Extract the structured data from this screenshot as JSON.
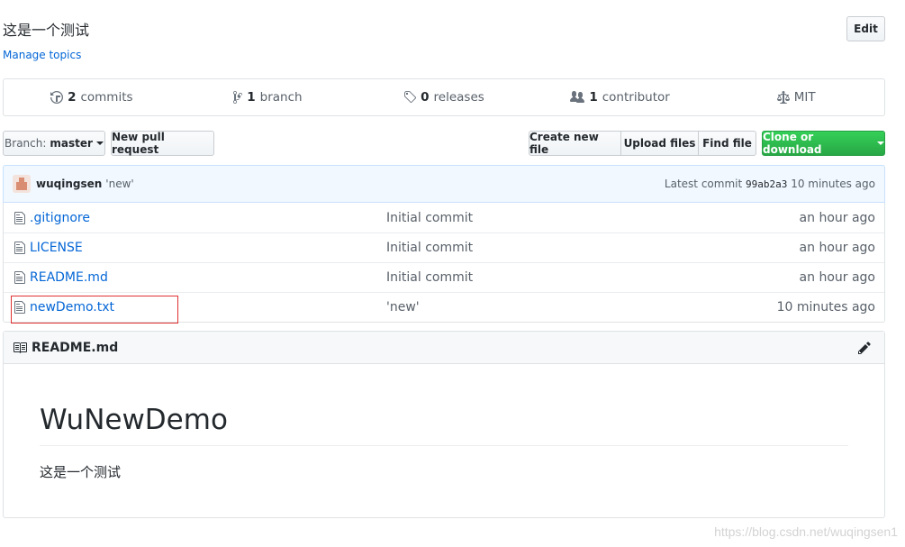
{
  "repo": {
    "description": "这是一个测试",
    "manage_topics": "Manage topics",
    "edit_label": "Edit"
  },
  "summary": {
    "commits_count": "2",
    "commits_label": "commits",
    "branch_count": "1",
    "branch_label": "branch",
    "releases_count": "0",
    "releases_label": "releases",
    "contributor_count": "1",
    "contributor_label": "contributor",
    "license": "MIT"
  },
  "toolbar": {
    "branch_prefix": "Branch:",
    "branch_name": "master",
    "new_pull_request": "New pull request",
    "create_new_file": "Create new file",
    "upload_files": "Upload files",
    "find_file": "Find file",
    "clone_or_download": "Clone or download"
  },
  "latest_commit": {
    "author": "wuqingsen",
    "message": "'new'",
    "label": "Latest commit",
    "sha": "99ab2a3",
    "age": "10 minutes ago"
  },
  "files": [
    {
      "name": ".gitignore",
      "message": "Initial commit",
      "age": "an hour ago"
    },
    {
      "name": "LICENSE",
      "message": "Initial commit",
      "age": "an hour ago"
    },
    {
      "name": "README.md",
      "message": "Initial commit",
      "age": "an hour ago"
    },
    {
      "name": "newDemo.txt",
      "message": "'new'",
      "age": "10 minutes ago"
    }
  ],
  "readme": {
    "filename": "README.md",
    "heading": "WuNewDemo",
    "body": "这是一个测试"
  },
  "watermark": "https://blog.csdn.net/wuqingsen1",
  "colors": {
    "link": "#0366d6",
    "clone_button": "#28a745",
    "commit_bar": "#f1f8ff",
    "highlight_box": "#e03131"
  }
}
